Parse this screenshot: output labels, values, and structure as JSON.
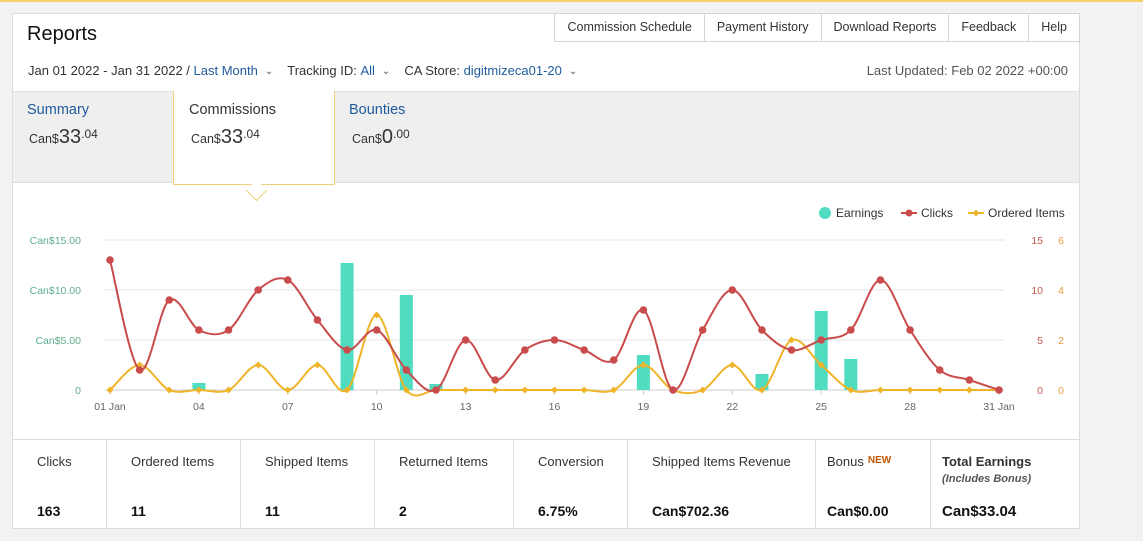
{
  "header": {
    "title": "Reports"
  },
  "topnav": [
    {
      "key": "commission_schedule",
      "label": "Commission Schedule"
    },
    {
      "key": "payment_history",
      "label": "Payment History"
    },
    {
      "key": "download_reports",
      "label": "Download Reports"
    },
    {
      "key": "feedback",
      "label": "Feedback"
    },
    {
      "key": "help",
      "label": "Help"
    }
  ],
  "filters": {
    "date_range": "Jan 01 2022 - Jan 31 2022 /",
    "period": "Last Month",
    "tracking_label": "Tracking ID:",
    "tracking_value": "All",
    "store_label": "CA Store:",
    "store_value": "digitmizeca01-20"
  },
  "last_updated": "Last Updated: Feb 02 2022 +00:00",
  "tabs": [
    {
      "label": "Summary",
      "currency": "Can$",
      "whole": "33",
      "decimal": ".04"
    },
    {
      "label": "Commissions",
      "currency": "Can$",
      "whole": "33",
      "decimal": ".04"
    },
    {
      "label": "Bounties",
      "currency": "Can$",
      "whole": "0",
      "decimal": ".00"
    }
  ],
  "stats": [
    {
      "label": "Clicks",
      "value": "163"
    },
    {
      "label": "Ordered Items",
      "value": "11"
    },
    {
      "label": "Shipped Items",
      "value": "11"
    },
    {
      "label": "Returned Items",
      "value": "2"
    },
    {
      "label": "Conversion",
      "value": "6.75%"
    },
    {
      "label": "Shipped Items Revenue",
      "value": "Can$702.36"
    },
    {
      "label": "Bonus",
      "badge": "NEW",
      "value": "Can$0.00"
    },
    {
      "label": "Total Earnings",
      "sublabel": "(Includes Bonus)",
      "value": "Can$33.04"
    }
  ],
  "chart_data": {
    "type": "bar+line",
    "legend": [
      "Earnings",
      "Clicks",
      "Ordered Items"
    ],
    "legend_position": "top-right",
    "grid": true,
    "x_ticks": [
      "01 Jan",
      "04",
      "07",
      "10",
      "13",
      "16",
      "19",
      "22",
      "25",
      "28",
      "31 Jan"
    ],
    "y_left": {
      "ticks": [
        "0",
        "Can$5.00",
        "Can$10.00",
        "Can$15.00"
      ],
      "range": [
        0,
        15
      ],
      "color": "#5dae8b"
    },
    "y_right_clicks": {
      "ticks": [
        "0",
        "5",
        "10",
        "15"
      ],
      "range": [
        0,
        15
      ],
      "color": "#c45a4c"
    },
    "y_right_items": {
      "ticks": [
        "0",
        "2",
        "4",
        "6"
      ],
      "range": [
        0,
        6
      ],
      "color": "#e49b3a"
    },
    "days": [
      1,
      2,
      3,
      4,
      5,
      6,
      7,
      8,
      9,
      10,
      11,
      12,
      13,
      14,
      15,
      16,
      17,
      18,
      19,
      20,
      21,
      22,
      23,
      24,
      25,
      26,
      27,
      28,
      29,
      30,
      31
    ],
    "series": [
      {
        "name": "Earnings",
        "type": "bar",
        "color": "#4fdcc0",
        "values": [
          0,
          0,
          0,
          0.7,
          0,
          0,
          0,
          0,
          12.7,
          0,
          9.5,
          0.6,
          0,
          0,
          0,
          0,
          0,
          0,
          3.5,
          0,
          0,
          0,
          1.6,
          0,
          7.9,
          3.1,
          0,
          0,
          0,
          0,
          0
        ]
      },
      {
        "name": "Clicks",
        "type": "line",
        "color": "#c94b4b",
        "values": [
          13,
          2,
          9,
          6,
          6,
          10,
          11,
          7,
          4,
          6,
          2,
          0,
          5,
          1,
          4,
          5,
          4,
          3,
          8,
          0,
          6,
          10,
          6,
          4,
          5,
          6,
          11,
          6,
          2,
          1,
          0
        ]
      },
      {
        "name": "Ordered Items",
        "type": "line",
        "color": "#f0b429",
        "values": [
          0,
          1,
          0,
          0,
          0,
          1,
          0,
          1,
          0,
          3,
          0,
          0,
          0,
          0,
          0,
          0,
          0,
          0,
          1,
          0,
          0,
          1,
          0,
          2,
          1,
          0,
          0,
          0,
          0,
          0,
          0
        ]
      }
    ]
  }
}
